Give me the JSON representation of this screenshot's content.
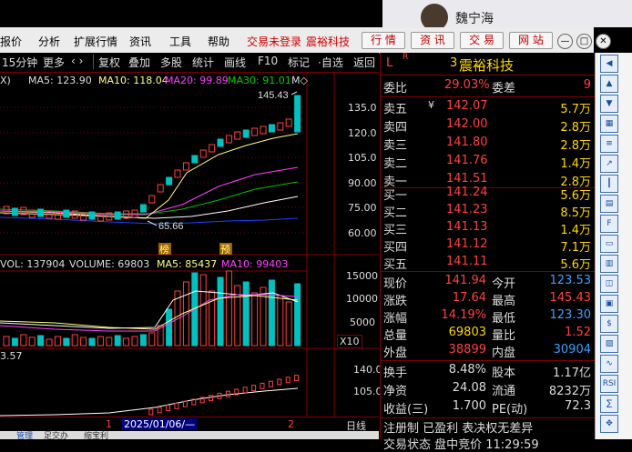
{
  "user": {
    "name": "魏宁海"
  },
  "menu": {
    "items": [
      "报价",
      "分析",
      "扩展行情",
      "资讯",
      "工具",
      "帮助"
    ],
    "status": "交易未登录",
    "stock": "震裕科技",
    "buttons": [
      "行 情",
      "资 讯",
      "交 易",
      "网 站"
    ]
  },
  "window": {
    "min": "—",
    "max": "□",
    "close": "✕"
  },
  "toolbar": {
    "period": "15分钟",
    "more": "更多",
    "arrows": "‹ ›",
    "items": [
      "复权",
      "叠加",
      "多股",
      "统计",
      "画线",
      "F10",
      "标记",
      "·自选",
      "返回"
    ]
  },
  "chart": {
    "kline_info": {
      "prefix": "X)",
      "ma5": "MA5: 123.90",
      "ma10": "MA10: 118.04",
      "ma20": "MA20: 99.89",
      "ma30": "MA30: 91.01",
      "more": "M◇"
    },
    "price_axis": [
      "135.0",
      "120.0",
      "105.0",
      "90.00",
      "75.00",
      "60.00"
    ],
    "high_label": "145.43",
    "low_label": "65.66",
    "tags": [
      "榜",
      "预"
    ],
    "vol_info": {
      "vol": "VOL: 137904",
      "volume": "VOLUME: 69803",
      "ma5": "MA5: 85437",
      "ma10": "MA10: 99403"
    },
    "vol_axis": [
      "15000",
      "10000",
      "5000"
    ],
    "vol_unit": "X10",
    "ind_value": "3.57",
    "ind_axis": [
      "140.0",
      "105.0"
    ],
    "date_marks": [
      "1",
      "2025/01/06/—",
      "2"
    ],
    "period_label": "日线",
    "bottom_tabs": [
      "管理",
      "足交办",
      "缩宝利"
    ]
  },
  "quote": {
    "mark_l": "L",
    "mark_r": "R",
    "code_num": "3",
    "name": "震裕科技",
    "weibi": {
      "label": "委比",
      "value": "29.03%",
      "label2": "委差",
      "value2": "9"
    },
    "sell": [
      {
        "label": "卖五",
        "price": "142.07",
        "vol": "5.7万",
        "mark": "¥"
      },
      {
        "label": "卖四",
        "price": "142.00",
        "vol": "2.8万"
      },
      {
        "label": "卖三",
        "price": "141.80",
        "vol": "2.8万"
      },
      {
        "label": "卖二",
        "price": "141.76",
        "vol": "1.4万"
      },
      {
        "label": "卖一",
        "price": "141.51",
        "vol": "2.8万"
      }
    ],
    "buy": [
      {
        "label": "买一",
        "price": "141.24",
        "vol": "5.6万"
      },
      {
        "label": "买二",
        "price": "141.23",
        "vol": "8.5万"
      },
      {
        "label": "买三",
        "price": "141.13",
        "vol": "1.4万"
      },
      {
        "label": "买四",
        "price": "141.12",
        "vol": "7.1万"
      },
      {
        "label": "买五",
        "price": "141.11",
        "vol": "5.6万"
      }
    ],
    "stats": [
      {
        "l1": "现价",
        "v1": "141.94",
        "l2": "今开",
        "v2": "123.53",
        "c2": "#3aa0ff"
      },
      {
        "l1": "涨跌",
        "v1": "17.64",
        "l2": "最高",
        "v2": "145.43",
        "c2": "#ff4040"
      },
      {
        "l1": "涨幅",
        "v1": "14.19%",
        "l2": "最低",
        "v2": "123.30",
        "c2": "#3aa0ff"
      },
      {
        "l1": "总量",
        "v1": "69803",
        "l2": "量比",
        "v2": "1.52",
        "c2": "#ff4040",
        "c1": "#ffd700"
      },
      {
        "l1": "外盘",
        "v1": "38899",
        "l2": "内盘",
        "v2": "30904",
        "c2": "#3aa0ff"
      }
    ],
    "stats2": [
      {
        "l1": "换手",
        "v1": "8.48%",
        "l2": "股本",
        "v2": "1.17亿"
      },
      {
        "l1": "净资",
        "v1": "24.08",
        "l2": "流通",
        "v2": "8232万"
      },
      {
        "l1": "收益(三)",
        "v1": "1.700",
        "l2": "PE(动)",
        "v2": "72.3"
      }
    ],
    "footer": "注册制 已盈利 表决权无差异",
    "footer2": "交易状态 盘中竞价 11:29:59"
  }
}
